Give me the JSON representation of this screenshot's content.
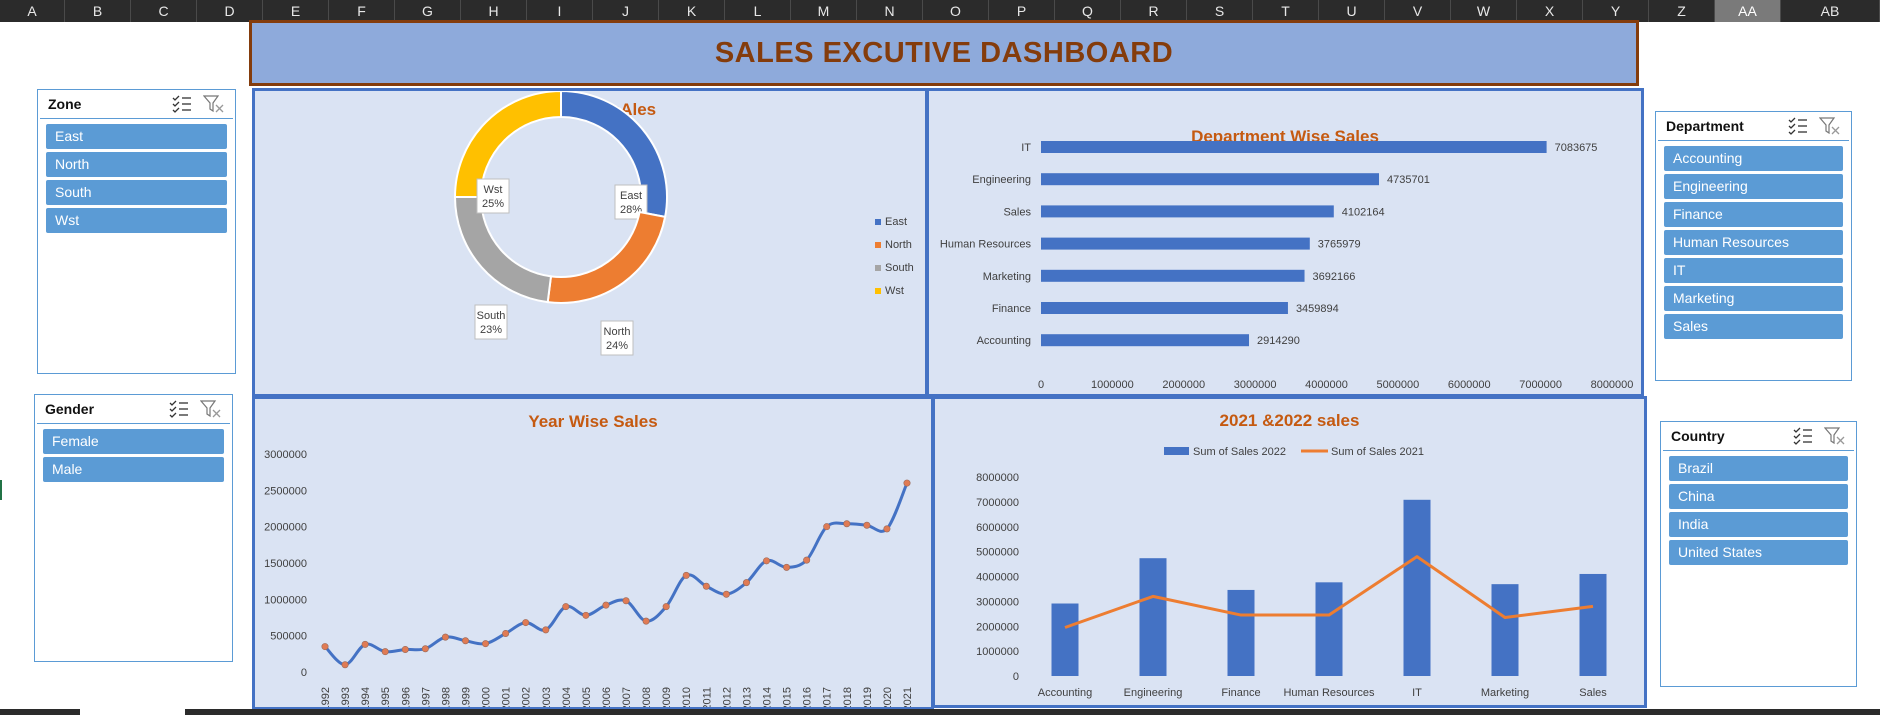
{
  "columns": [
    "A",
    "B",
    "C",
    "D",
    "E",
    "F",
    "G",
    "H",
    "I",
    "J",
    "K",
    "L",
    "M",
    "N",
    "O",
    "P",
    "Q",
    "R",
    "S",
    "T",
    "U",
    "V",
    "W",
    "X",
    "Y",
    "Z",
    "AA",
    "AB"
  ],
  "selected_column": "AA",
  "dashboard_title": "SALES EXCUTIVE DASHBOARD",
  "slicers": {
    "zone": {
      "label": "Zone",
      "items": [
        "East",
        "North",
        "South",
        "Wst"
      ]
    },
    "gender": {
      "label": "Gender",
      "items": [
        "Female",
        "Male"
      ]
    },
    "department": {
      "label": "Department",
      "items": [
        "Accounting",
        "Engineering",
        "Finance",
        "Human Resources",
        "IT",
        "Marketing",
        "Sales"
      ]
    },
    "country": {
      "label": "Country",
      "items": [
        "Brazil",
        "China",
        "India",
        "United States"
      ]
    }
  },
  "colors": {
    "east": "#4472c4",
    "north": "#ed7d31",
    "south": "#a5a5a5",
    "wst": "#ffc000",
    "accent_title": "#c55a11",
    "panel_bg": "#dae3f3",
    "panel_border": "#4472c4",
    "slicer_item": "#5b9bd5",
    "banner_bg": "#8eaadb",
    "banner_text": "#843c0c",
    "line": "#4472c4",
    "marker": "#e07b54"
  },
  "chart_data": [
    {
      "type": "pie",
      "title": "Zone wise sAles",
      "categories": [
        "East",
        "North",
        "South",
        "Wst"
      ],
      "values": [
        28,
        24,
        23,
        25
      ],
      "data_labels": [
        "28%",
        "24%",
        "23%",
        "25%"
      ],
      "legend": "right"
    },
    {
      "type": "bar",
      "orientation": "horizontal",
      "title": "Department Wise Sales",
      "categories": [
        "IT",
        "Engineering",
        "Sales",
        "Human Resources",
        "Marketing",
        "Finance",
        "Accounting"
      ],
      "values": [
        7083675,
        4735701,
        4102164,
        3765979,
        3692166,
        3459894,
        2914290
      ],
      "xlim": [
        0,
        8000000
      ],
      "xticks": [
        0,
        1000000,
        2000000,
        3000000,
        4000000,
        5000000,
        6000000,
        7000000,
        8000000
      ]
    },
    {
      "type": "line",
      "title": "Year Wise Sales",
      "x": [
        "1992",
        "1993",
        "1994",
        "1995",
        "1996",
        "1997",
        "1998",
        "1999",
        "2000",
        "2001",
        "2002",
        "2003",
        "2004",
        "2005",
        "2006",
        "2007",
        "2008",
        "2009",
        "2010",
        "2011",
        "2012",
        "2013",
        "2014",
        "2015",
        "2016",
        "2017",
        "2018",
        "2019",
        "2020",
        "2021"
      ],
      "values": [
        350000,
        100000,
        380000,
        280000,
        310000,
        320000,
        480000,
        430000,
        390000,
        530000,
        680000,
        580000,
        900000,
        780000,
        920000,
        980000,
        700000,
        900000,
        1330000,
        1180000,
        1070000,
        1230000,
        1530000,
        1440000,
        1540000,
        2000000,
        2040000,
        2020000,
        1970000,
        2600000
      ],
      "ylim": [
        0,
        3000000
      ],
      "yticks": [
        0,
        500000,
        1000000,
        1500000,
        2000000,
        2500000,
        3000000
      ]
    },
    {
      "type": "bar",
      "title": "2021 &2022 sales",
      "categories": [
        "Accounting",
        "Engineering",
        "Finance",
        "Human Resources",
        "IT",
        "Marketing",
        "Sales"
      ],
      "series": [
        {
          "name": "Sum of Sales 2022",
          "kind": "bar",
          "values": [
            2914290,
            4735701,
            3459894,
            3765979,
            7083675,
            3692166,
            4102164
          ]
        },
        {
          "name": "Sum of Sales 2021",
          "kind": "line",
          "values": [
            1950000,
            3200000,
            2450000,
            2450000,
            4800000,
            2350000,
            2800000
          ]
        }
      ],
      "ylim": [
        0,
        8000000
      ],
      "yticks": [
        0,
        1000000,
        2000000,
        3000000,
        4000000,
        5000000,
        6000000,
        7000000,
        8000000
      ],
      "legend": "top"
    }
  ]
}
